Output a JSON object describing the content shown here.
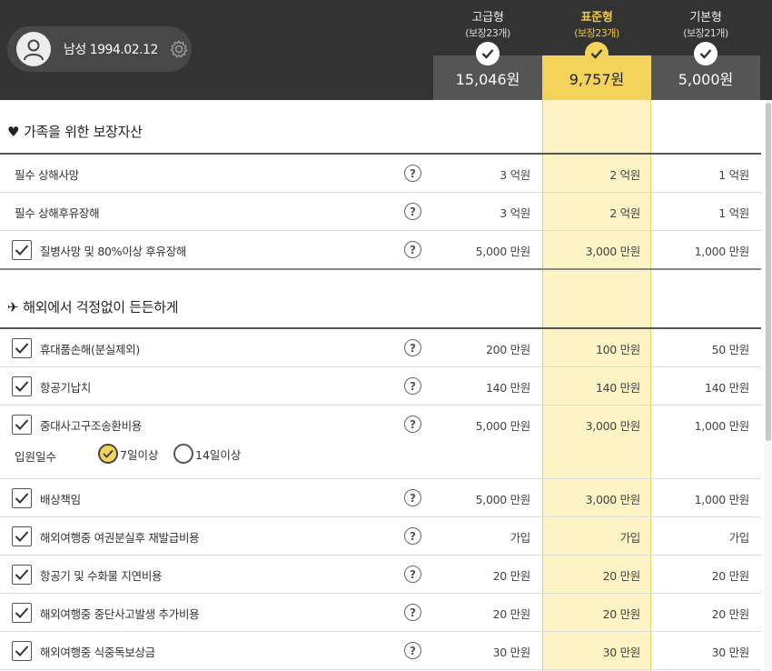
{
  "profile": {
    "text": "남성 1994.02.12"
  },
  "plans": [
    {
      "name": "고급형",
      "count": "(보장23개)",
      "price": "15,046원",
      "selected": false
    },
    {
      "name": "표준형",
      "count": "(보장23개)",
      "price": "9,757원",
      "selected": true
    },
    {
      "name": "기본형",
      "count": "(보장21개)",
      "price": "5,000원",
      "selected": false
    }
  ],
  "sections": {
    "family": {
      "title": "가족을 위한 보장자산",
      "rows": [
        {
          "label": "필수 상해사망",
          "values": [
            "3 억원",
            "2 억원",
            "1 억원"
          ]
        },
        {
          "label": "필수 상해후유장해",
          "values": [
            "3 억원",
            "2 억원",
            "1 억원"
          ]
        },
        {
          "label": "질병사망 및 80%이상 후유장해",
          "values": [
            "5,000 만원",
            "3,000 만원",
            "1,000 만원"
          ]
        }
      ]
    },
    "overseas": {
      "title": "해외에서 걱정없이 든든하게",
      "rows": [
        {
          "label": "휴대품손해(분실제외)",
          "values": [
            "200 만원",
            "100 만원",
            "50 만원"
          ]
        },
        {
          "label": "항공기납치",
          "values": [
            "140 만원",
            "140 만원",
            "140 만원"
          ]
        },
        {
          "label": "중대사고구조송환비용",
          "values": [
            "5,000 만원",
            "3,000 만원",
            "1,000 만원"
          ]
        },
        {
          "label": "배상책임",
          "values": [
            "5,000 만원",
            "3,000 만원",
            "1,000 만원"
          ]
        },
        {
          "label": "해외여행중 여권분실후 재발급비용",
          "values": [
            "가입",
            "가입",
            "가입"
          ]
        },
        {
          "label": "항공기 및 수화물 지연비용",
          "values": [
            "20 만원",
            "20 만원",
            "20 만원"
          ]
        },
        {
          "label": "해외여행중 중단사고발생 추가비용",
          "values": [
            "20 만원",
            "20 만원",
            "20 만원"
          ]
        },
        {
          "label": "해외여행중 식중독보상금",
          "values": [
            "30 만원",
            "30 만원",
            "30 만원"
          ]
        }
      ]
    }
  },
  "hospital": {
    "label": "입원일수",
    "options": [
      "7일이상",
      "14일이상"
    ],
    "selected": "7일이상"
  },
  "help_glyph": "?",
  "colors": {
    "header_bg": "#333333",
    "accent": "#f3d35a",
    "price_bg": "#555555"
  }
}
